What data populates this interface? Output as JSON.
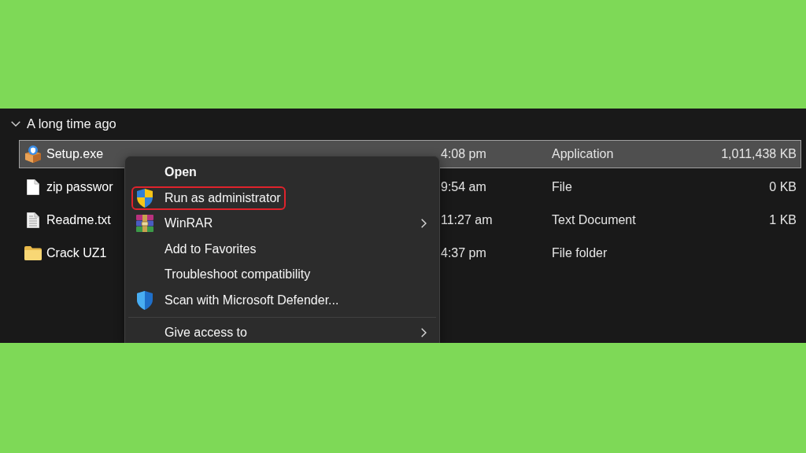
{
  "group": {
    "label": "A long time ago",
    "expanded": true
  },
  "files": [
    {
      "kind": "installer",
      "name": "Setup.exe",
      "column_2": "4:08 pm",
      "column_3": "Application",
      "column_4": "1,011,438 KB",
      "selected": true
    },
    {
      "kind": "blank",
      "name": "zip passwor",
      "column_2": "9:54 am",
      "column_3": "File",
      "column_4": "0 KB",
      "selected": false
    },
    {
      "kind": "text",
      "name": "Readme.txt",
      "column_2": "11:27 am",
      "column_3": "Text Document",
      "column_4": "1 KB",
      "selected": false
    },
    {
      "kind": "folder",
      "name": "Crack UZ1",
      "column_2": "4:37 pm",
      "column_3": "File folder",
      "selected": false
    }
  ],
  "context_menu": {
    "sections": [
      {
        "items": [
          {
            "kind": "plain",
            "label": "Open",
            "default": true,
            "submenu": false,
            "highlighted": false
          },
          {
            "kind": "elevate",
            "label": "Run as administrator",
            "default": false,
            "submenu": false,
            "highlighted": true
          },
          {
            "kind": "archive",
            "label": "WinRAR",
            "default": false,
            "submenu": true,
            "highlighted": false
          },
          {
            "kind": "plain",
            "label": "Add to Favorites",
            "default": false,
            "submenu": false,
            "highlighted": false
          },
          {
            "kind": "plain",
            "label": "Troubleshoot compatibility",
            "default": false,
            "submenu": false,
            "highlighted": false
          },
          {
            "kind": "scan",
            "label": "Scan with Microsoft Defender...",
            "default": false,
            "submenu": false,
            "highlighted": false
          }
        ]
      },
      {
        "items": [
          {
            "kind": "plain",
            "label": "Give access to",
            "default": false,
            "submenu": true,
            "highlighted": false
          }
        ]
      }
    ]
  }
}
